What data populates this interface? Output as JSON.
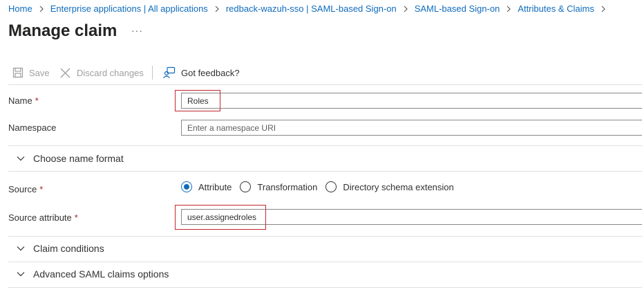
{
  "breadcrumb": [
    {
      "label": "Home"
    },
    {
      "label": "Enterprise applications | All applications"
    },
    {
      "label": "redback-wazuh-sso | SAML-based Sign-on"
    },
    {
      "label": "SAML-based Sign-on"
    },
    {
      "label": "Attributes & Claims"
    }
  ],
  "page": {
    "title": "Manage claim",
    "more_label": "···"
  },
  "toolbar": {
    "save_label": "Save",
    "discard_label": "Discard changes",
    "feedback_label": "Got feedback?",
    "save_icon": "save-icon",
    "discard_icon": "close-icon",
    "feedback_icon": "feedback-icon"
  },
  "form": {
    "name": {
      "label": "Name",
      "required": "*",
      "value": "Roles"
    },
    "namespace": {
      "label": "Namespace",
      "placeholder": "Enter a namespace URI",
      "value": ""
    },
    "name_format": {
      "label": "Choose name format"
    },
    "source": {
      "label": "Source",
      "required": "*",
      "options": [
        {
          "label": "Attribute",
          "selected": true
        },
        {
          "label": "Transformation",
          "selected": false
        },
        {
          "label": "Directory schema extension",
          "selected": false
        }
      ]
    },
    "source_attribute": {
      "label": "Source attribute",
      "required": "*",
      "value": "user.assignedroles"
    },
    "claim_conditions": {
      "label": "Claim conditions"
    },
    "advanced_options": {
      "label": "Advanced SAML claims options"
    }
  },
  "colors": {
    "accent": "#0f6cbd",
    "required": "#a4262c",
    "highlight_box": "#c1272d"
  }
}
